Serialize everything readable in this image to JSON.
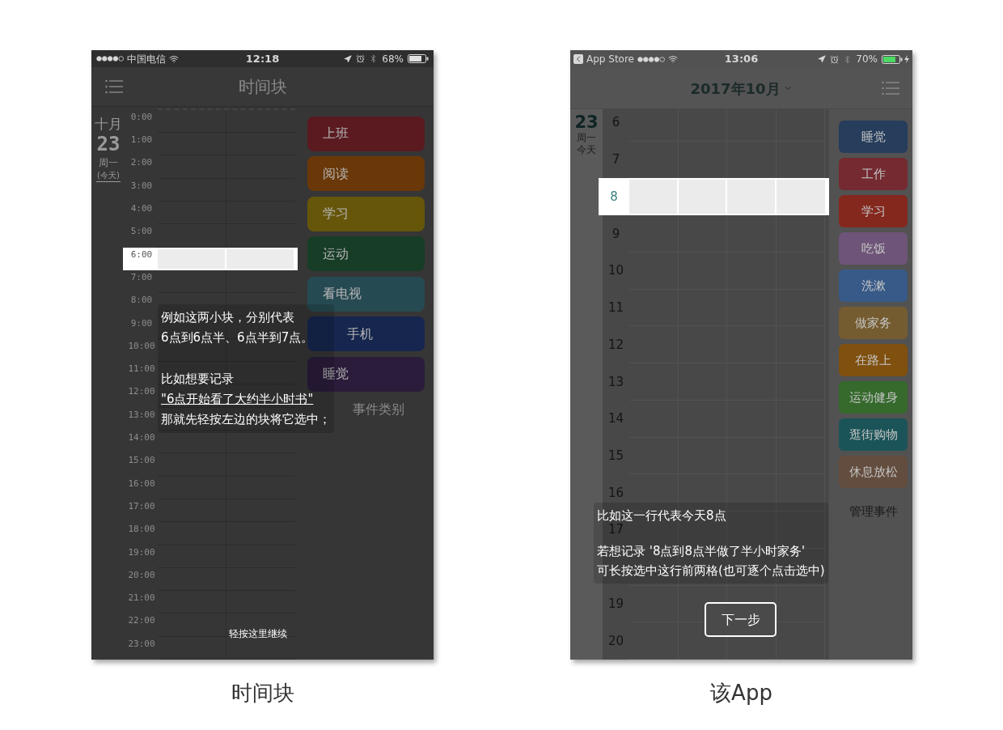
{
  "left_screen": {
    "status_bar": {
      "carrier": "中国电信",
      "time": "12:18",
      "battery": "68%",
      "charging": false
    },
    "nav": {
      "title": "时间块"
    },
    "date": {
      "month": "十月",
      "day": "23",
      "weekday": "周一",
      "today": "(今天)"
    },
    "hours": [
      {
        "label": "0:00",
        "selected": false
      },
      {
        "label": "1:00",
        "selected": false
      },
      {
        "label": "2:00",
        "selected": false
      },
      {
        "label": "3:00",
        "selected": false
      },
      {
        "label": "4:00",
        "selected": false
      },
      {
        "label": "5:00",
        "selected": false
      },
      {
        "label": "6:00",
        "selected": true
      },
      {
        "label": "7:00",
        "selected": false
      },
      {
        "label": "8:00",
        "selected": false
      },
      {
        "label": "9:00",
        "selected": false
      },
      {
        "label": "10:00",
        "selected": false
      },
      {
        "label": "11:00",
        "selected": false
      },
      {
        "label": "12:00",
        "selected": false
      },
      {
        "label": "13:00",
        "selected": false
      },
      {
        "label": "14:00",
        "selected": false
      },
      {
        "label": "15:00",
        "selected": false
      },
      {
        "label": "16:00",
        "selected": false
      },
      {
        "label": "17:00",
        "selected": false
      },
      {
        "label": "18:00",
        "selected": false
      },
      {
        "label": "19:00",
        "selected": false
      },
      {
        "label": "20:00",
        "selected": false
      },
      {
        "label": "21:00",
        "selected": false
      },
      {
        "label": "22:00",
        "selected": false
      },
      {
        "label": "23:00",
        "selected": false
      }
    ],
    "categories": [
      {
        "label": "上班",
        "color": "#5a1a20"
      },
      {
        "label": "阅读",
        "color": "#6a3808"
      },
      {
        "label": "学习",
        "color": "#66560a"
      },
      {
        "label": "运动",
        "color": "#173d26"
      },
      {
        "label": "看电视",
        "color": "#264a52"
      },
      {
        "label": "手机",
        "color": "#16264e"
      },
      {
        "label": "睡觉",
        "color": "#2a1c3a"
      }
    ],
    "more_link": "事件类别",
    "guide": [
      {
        "lines": [
          {
            "text": "例如这两小块，分别代表",
            "underlined": false
          },
          {
            "text": "6点到6点半、6点半到7点。",
            "underlined": false
          }
        ]
      },
      {
        "lines": [
          {
            "text": "比如想要记录",
            "underlined": false
          },
          {
            "text": "\"6点开始看了大约半小时书\"",
            "underlined": true
          },
          {
            "text": "那就先轻按左边的块将它选中；",
            "underlined": false
          }
        ]
      }
    ],
    "continue_hint": "轻按这里继续"
  },
  "right_screen": {
    "status_bar": {
      "back_app": "App Store",
      "time": "13:06",
      "battery": "70%",
      "charging": true
    },
    "nav": {
      "title": "2017年10月"
    },
    "date": {
      "day": "23",
      "weekday": "周一",
      "today": "今天"
    },
    "hours": [
      {
        "kind": "hour",
        "label": "6",
        "selected": false
      },
      {
        "kind": "hour",
        "label": "7",
        "selected": false
      },
      {
        "kind": "hour",
        "label": "8",
        "selected": true
      },
      {
        "kind": "hour",
        "label": "9",
        "selected": false
      },
      {
        "kind": "hour",
        "label": "10",
        "selected": false
      },
      {
        "kind": "hour",
        "label": "11",
        "selected": false
      },
      {
        "kind": "hour",
        "label": "12",
        "selected": false
      },
      {
        "kind": "hour",
        "label": "13",
        "selected": false
      },
      {
        "kind": "hour",
        "label": "14",
        "selected": false
      },
      {
        "kind": "hour",
        "label": "15",
        "selected": false
      },
      {
        "kind": "hour",
        "label": "16",
        "selected": false
      },
      {
        "kind": "hour",
        "label": "17",
        "selected": false
      },
      {
        "kind": "blank",
        "selected": false
      },
      {
        "kind": "hour",
        "label": "19",
        "selected": false
      },
      {
        "kind": "hour",
        "label": "20",
        "selected": false
      }
    ],
    "categories": [
      {
        "label": "睡觉",
        "color": "#263d5c"
      },
      {
        "label": "工作",
        "color": "#742a30"
      },
      {
        "label": "学习",
        "color": "#84281e"
      },
      {
        "label": "吃饭",
        "color": "#6e5478"
      },
      {
        "label": "洗漱",
        "color": "#375a88"
      },
      {
        "label": "做家务",
        "color": "#745c30"
      },
      {
        "label": "在路上",
        "color": "#80500f"
      },
      {
        "label": "运动健身",
        "color": "#356a2c"
      },
      {
        "label": "逛街购物",
        "color": "#1b5458"
      },
      {
        "label": "休息放松",
        "color": "#634d3e"
      }
    ],
    "manage_link": "管理事件",
    "guide": [
      {
        "lines": [
          "比如这一行代表今天8点"
        ]
      },
      {
        "lines": [
          "若想记录 '8点到8点半做了半小时家务'",
          "可长按选中这行前两格(也可逐个点击选中)"
        ]
      }
    ],
    "next_button": "下一步"
  },
  "captions": [
    "时间块",
    "该App"
  ]
}
